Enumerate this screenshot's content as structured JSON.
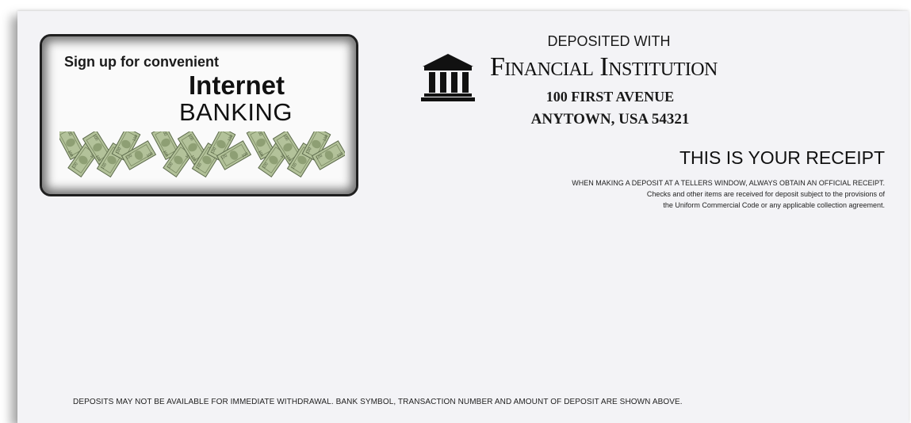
{
  "promo": {
    "tagline": "Sign up for convenient",
    "headline": "Internet",
    "subheadline": "BANKING",
    "illustration_icon": "dollar-bills-w-icon"
  },
  "bank": {
    "symbol_icon": "bank-building-icon",
    "deposited_with": "DEPOSITED WITH",
    "name": "Financial Institution",
    "address_line_1": "100 FIRST AVENUE",
    "address_line_2": "ANYTOWN, USA 54321"
  },
  "receipt": {
    "title": "THIS IS YOUR RECEIPT",
    "notice_line_1": "WHEN MAKING A DEPOSIT AT A TELLERS WINDOW, ALWAYS OBTAIN AN OFFICIAL RECEIPT.",
    "notice_line_2": "Checks and other items are received for deposit subject to the provisions of",
    "notice_line_3": "the Uniform Commercial Code or any applicable collection agreement."
  },
  "footer": {
    "notice": "DEPOSITS MAY NOT BE AVAILABLE FOR IMMEDIATE WITHDRAWAL. BANK SYMBOL, TRANSACTION NUMBER AND AMOUNT OF DEPOSIT ARE SHOWN ABOVE."
  },
  "colors": {
    "paper": "#f3f3f6",
    "ink": "#111111",
    "money_green": "#a7b98a"
  }
}
